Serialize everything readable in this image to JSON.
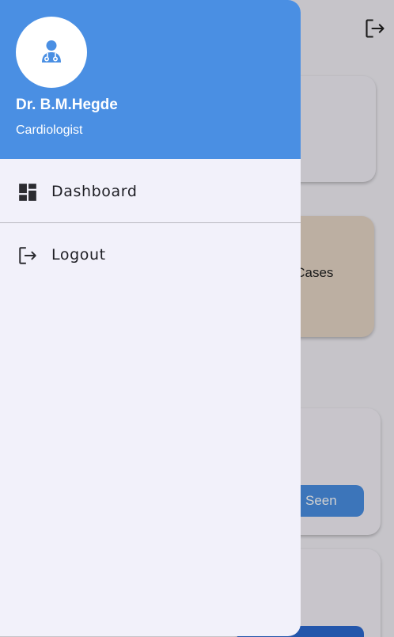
{
  "background": {
    "card_label": "y Cases",
    "seen_button_label": "Seen",
    "logout_icon": "logout-icon"
  },
  "drawer": {
    "profile": {
      "avatar_icon": "doctor-icon",
      "name": "Dr. B.M.Hegde",
      "specialty": "Cardiologist"
    },
    "items": [
      {
        "icon": "dashboard-icon",
        "label": "Dashboard"
      },
      {
        "icon": "logout-icon",
        "label": "Logout"
      }
    ]
  },
  "colors": {
    "header": "#4a8fe3",
    "drawer_bg": "#f2f1fa",
    "text": "#1e1e24"
  }
}
